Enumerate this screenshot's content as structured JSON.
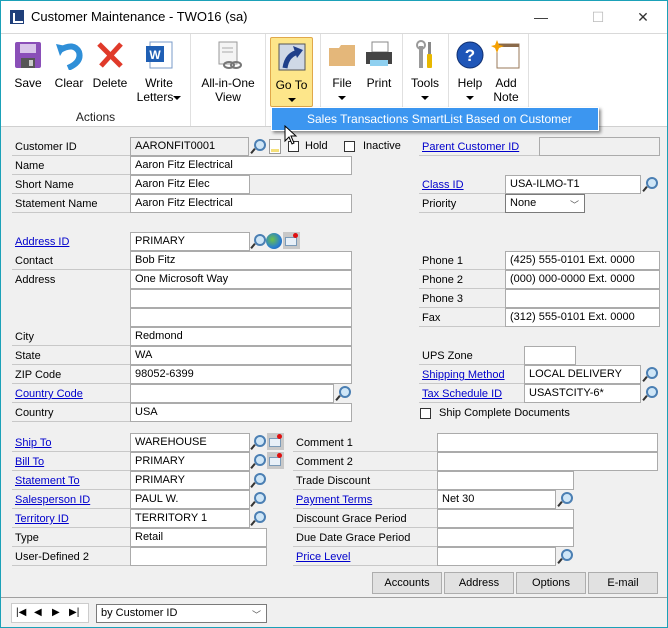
{
  "window": {
    "title": "Customer Maintenance  -  TWO16 (sa)",
    "minimize": "—",
    "maximize": "☐",
    "close": "✕"
  },
  "ribbon": {
    "actions_group_label": "Actions",
    "buttons": {
      "save": "Save",
      "clear": "Clear",
      "delete": "Delete",
      "write_letters_1": "Write",
      "write_letters_2": "Letters",
      "all_in_one_1": "All-in-One",
      "all_in_one_2": "View",
      "goto": "Go To",
      "file": "File",
      "print": "Print",
      "tools": "Tools",
      "help": "Help",
      "add_note_1": "Add",
      "add_note_2": "Note"
    },
    "goto_menu": {
      "items": [
        "Sales Transactions SmartList Based on Customer"
      ]
    }
  },
  "form": {
    "customer_id": {
      "label": "Customer ID",
      "value": "AARONFIT0001"
    },
    "hold": {
      "label": "Hold",
      "checked": false
    },
    "inactive": {
      "label": "Inactive",
      "checked": false
    },
    "parent_customer_id": {
      "label": "Parent Customer ID",
      "value": ""
    },
    "name": {
      "label": "Name",
      "value": "Aaron Fitz Electrical"
    },
    "short_name": {
      "label": "Short Name",
      "value": "Aaron Fitz Elec"
    },
    "statement_name": {
      "label": "Statement Name",
      "value": "Aaron Fitz Electrical"
    },
    "class_id": {
      "label": "Class ID",
      "value": "USA-ILMO-T1"
    },
    "priority": {
      "label": "Priority",
      "value": "None"
    },
    "address_id": {
      "label": "Address ID",
      "value": "PRIMARY"
    },
    "contact": {
      "label": "Contact",
      "value": "Bob Fitz"
    },
    "address": {
      "label": "Address",
      "line1": "One Microsoft Way",
      "line2": "",
      "line3": ""
    },
    "city": {
      "label": "City",
      "value": "Redmond"
    },
    "state": {
      "label": "State",
      "value": "WA"
    },
    "zip": {
      "label": "ZIP Code",
      "value": "98052-6399"
    },
    "country_code": {
      "label": "Country Code",
      "value": ""
    },
    "country": {
      "label": "Country",
      "value": "USA"
    },
    "phone1": {
      "label": "Phone 1",
      "value": "(425) 555-0101  Ext. 0000"
    },
    "phone2": {
      "label": "Phone 2",
      "value": "(000) 000-0000  Ext. 0000"
    },
    "phone3": {
      "label": "Phone 3",
      "value": ""
    },
    "fax": {
      "label": "Fax",
      "value": "(312) 555-0101  Ext. 0000"
    },
    "ups_zone": {
      "label": "UPS Zone",
      "value": ""
    },
    "shipping_method": {
      "label": "Shipping Method",
      "value": "LOCAL DELIVERY"
    },
    "tax_schedule_id": {
      "label": "Tax Schedule ID",
      "value": "USASTCITY-6*"
    },
    "ship_complete": {
      "label": "Ship Complete Documents",
      "checked": false
    },
    "ship_to": {
      "label": "Ship To",
      "value": "WAREHOUSE"
    },
    "bill_to": {
      "label": "Bill To",
      "value": "PRIMARY"
    },
    "statement_to": {
      "label": "Statement To",
      "value": "PRIMARY"
    },
    "salesperson_id": {
      "label": "Salesperson ID",
      "value": "PAUL W."
    },
    "territory_id": {
      "label": "Territory ID",
      "value": "TERRITORY 1"
    },
    "type": {
      "label": "Type",
      "value": "Retail"
    },
    "user_defined_2": {
      "label": "User-Defined 2",
      "value": ""
    },
    "comment1": {
      "label": "Comment 1",
      "value": ""
    },
    "comment2": {
      "label": "Comment 2",
      "value": ""
    },
    "trade_discount": {
      "label": "Trade Discount",
      "value": ""
    },
    "payment_terms": {
      "label": "Payment Terms",
      "value": "Net 30"
    },
    "discount_grace": {
      "label": "Discount Grace Period",
      "value": ""
    },
    "due_date_grace": {
      "label": "Due Date Grace Period",
      "value": ""
    },
    "price_level": {
      "label": "Price Level",
      "value": ""
    }
  },
  "buttons": {
    "accounts": "Accounts",
    "address": "Address",
    "options": "Options",
    "email": "E-mail"
  },
  "footer": {
    "nav": {
      "first": "|◀",
      "prev": "◀",
      "next": "▶",
      "last": "▶|"
    },
    "sort_by": "by Customer ID"
  }
}
